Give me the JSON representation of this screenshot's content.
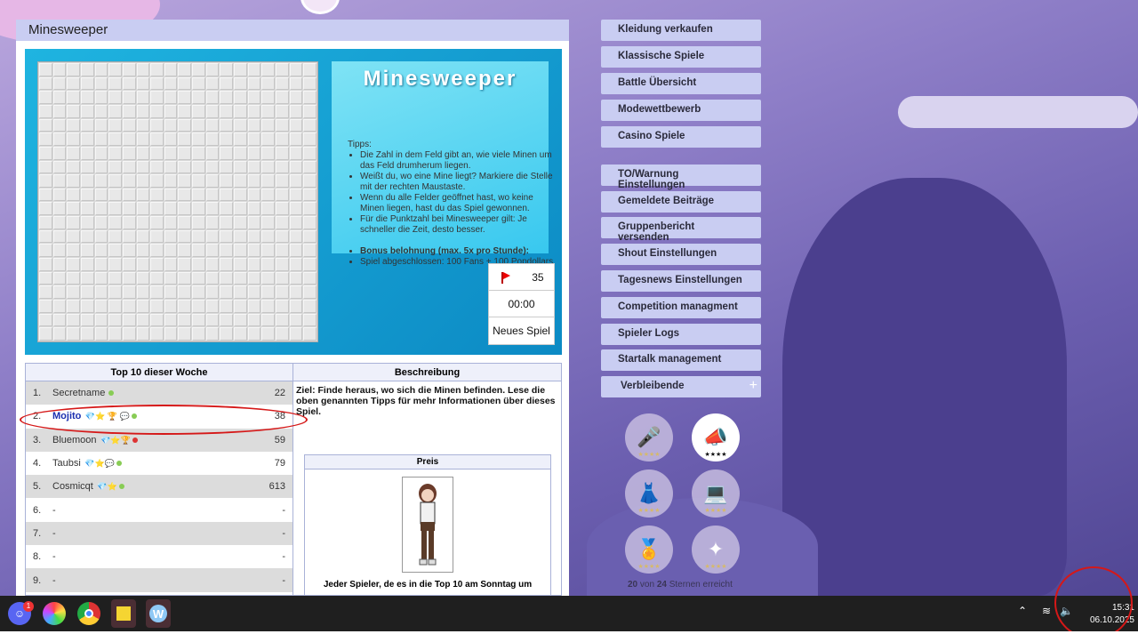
{
  "window": {
    "title": "Minesweeper"
  },
  "game": {
    "logo": "Minesweeper",
    "tips_heading": "Tipps:",
    "tips": [
      "Die Zahl in dem Feld gibt an, wie viele Minen um das Feld drumherum liegen.",
      "Weißt du, wo eine Mine liegt? Markiere die Stelle mit der rechten Maustaste.",
      "Wenn du alle Felder geöffnet hast, wo keine Minen liegen, hast du das Spiel gewonnen.",
      "Für die Punktzahl bei Minesweeper gilt: Je schneller die Zeit, desto besser."
    ],
    "bonus_title": "Bonus belohnung (max. 5x pro Stunde):",
    "bonus_text": "Spiel abgeschlossen: 100 Fans + 100 Popdollars",
    "mines_left": "35",
    "timer": "00:00",
    "new_game_label": "Neues Spiel"
  },
  "top10": {
    "heading": "Top 10 dieser Woche",
    "rows": [
      {
        "rank": "1.",
        "name": "Secretname",
        "points": "22"
      },
      {
        "rank": "2.",
        "name": "Mojito",
        "points": "38"
      },
      {
        "rank": "3.",
        "name": "Bluemoon",
        "points": "59"
      },
      {
        "rank": "4.",
        "name": "Taubsi",
        "points": "79"
      },
      {
        "rank": "5.",
        "name": "Cosmicqt",
        "points": "613"
      },
      {
        "rank": "6.",
        "name": "-",
        "points": "-"
      },
      {
        "rank": "7.",
        "name": "-",
        "points": "-"
      },
      {
        "rank": "8.",
        "name": "-",
        "points": "-"
      },
      {
        "rank": "9.",
        "name": "-",
        "points": "-"
      }
    ]
  },
  "description": {
    "heading": "Beschreibung",
    "text": "Ziel: Finde heraus, wo sich die Minen befinden. Lese die oben genannten Tipps für mehr Informationen über dieses Spiel.",
    "prize_heading": "Preis",
    "prize_text": "Jeder Spieler, de es in die Top 10 am Sonntag um"
  },
  "menu": [
    "Kleidung verkaufen",
    "Klassische Spiele",
    "Battle Übersicht",
    "Modewettbewerb",
    "Casino Spiele",
    "TO/Warnung Einstellungen",
    "Gemeldete Beiträge",
    "Gruppenbericht versenden",
    "Shout Einstellungen",
    "Tagesnews Einstellungen",
    "Competition managment",
    "Spieler Logs",
    "Startalk management",
    "Verbleibende"
  ],
  "achievements": {
    "stars_earned": "20",
    "stars_total": "24",
    "von": "von",
    "suffix": "Sternen erreicht",
    "star_glyph": "★★★★"
  },
  "taskbar": {
    "discord_badge": "1",
    "time": "15:31",
    "date": "06.10.2025"
  }
}
